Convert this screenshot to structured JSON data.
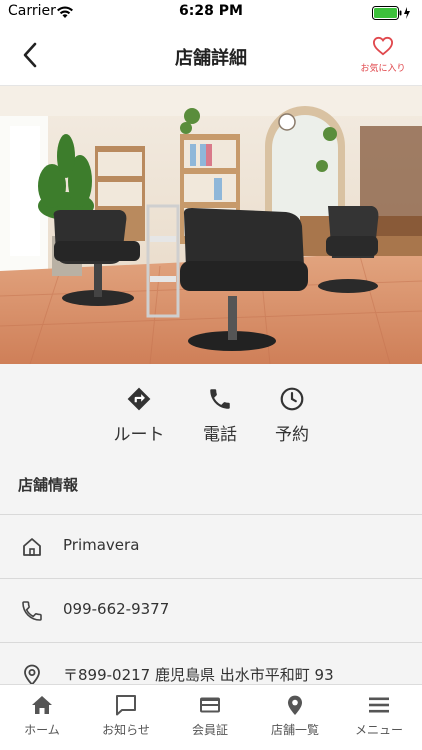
{
  "status_bar": {
    "carrier": "Carrier",
    "time": "6:28 PM"
  },
  "navbar": {
    "title": "店舗詳細",
    "favorite_label": "お気に入り",
    "accent_color": "#e0484d"
  },
  "actions": [
    {
      "label": "ルート",
      "icon": "directions-icon"
    },
    {
      "label": "電話",
      "icon": "phone-icon"
    },
    {
      "label": "予約",
      "icon": "clock-icon"
    }
  ],
  "store_info": {
    "section_title": "店舗情報",
    "name": "Primavera",
    "phone": "099-662-9377",
    "address": "〒899-0217 鹿児島県 出水市平和町 93"
  },
  "tabbar": [
    {
      "label": "ホーム",
      "icon": "home-icon"
    },
    {
      "label": "お知らせ",
      "icon": "message-icon"
    },
    {
      "label": "会員証",
      "icon": "card-icon"
    },
    {
      "label": "店舗一覧",
      "icon": "map-pin-icon"
    },
    {
      "label": "メニュー",
      "icon": "menu-icon"
    }
  ]
}
